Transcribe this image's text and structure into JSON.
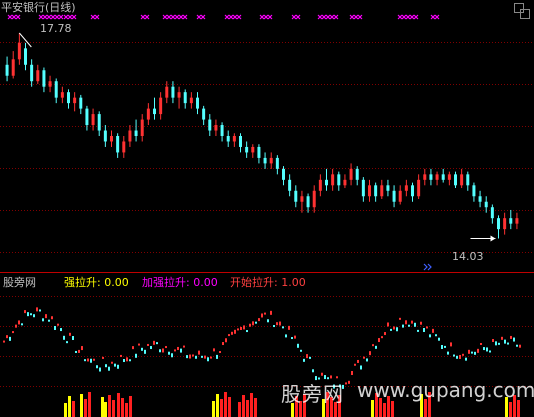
{
  "title_label": "平安银行(日线)",
  "high_label": "17.78",
  "low_label": "14.03",
  "indicator": {
    "name": "股旁网",
    "v1": "强拉升: 0.00",
    "v2": "加强拉升: 0.00",
    "v3": "开始拉升: 1.00"
  },
  "watermark": {
    "cn": "股旁网",
    "url": "www.gupang.com"
  },
  "colors": {
    "background": "#000000",
    "up": "#ff3232",
    "down": "#54ffff",
    "grid": "#800000",
    "separator": "#c00000",
    "marker": "#ff00ff",
    "text_label": "#c0c0c0",
    "v1": "#ffff00",
    "v2": "#ff00ff",
    "v3": "#ff4040",
    "bar_yellow": "#ffff00",
    "bar_red": "#ff2020"
  },
  "icons": {
    "marker": "magenta-x-marker",
    "arrow": "arrow-marker"
  },
  "chart_data": {
    "type": "candlestick",
    "ylim": [
      13.6,
      18.2
    ],
    "price_high": 17.78,
    "price_low": 14.03,
    "candles": [
      [
        17.2,
        17.0,
        17.35,
        16.9
      ],
      [
        17.0,
        17.3,
        17.45,
        16.95
      ],
      [
        17.3,
        17.6,
        17.78,
        17.2
      ],
      [
        17.5,
        17.2,
        17.6,
        17.1
      ],
      [
        17.2,
        16.9,
        17.3,
        16.8
      ],
      [
        16.9,
        17.1,
        17.2,
        16.85
      ],
      [
        17.1,
        16.8,
        17.15,
        16.7
      ],
      [
        16.8,
        16.9,
        17.0,
        16.7
      ],
      [
        16.9,
        16.6,
        16.95,
        16.5
      ],
      [
        16.6,
        16.7,
        16.8,
        16.5
      ],
      [
        16.7,
        16.5,
        16.75,
        16.4
      ],
      [
        16.5,
        16.6,
        16.7,
        16.35
      ],
      [
        16.6,
        16.4,
        16.65,
        16.3
      ],
      [
        16.4,
        16.1,
        16.45,
        16.0
      ],
      [
        16.1,
        16.3,
        16.4,
        16.0
      ],
      [
        16.3,
        16.0,
        16.35,
        15.9
      ],
      [
        16.0,
        15.8,
        16.1,
        15.7
      ],
      [
        15.8,
        15.9,
        16.0,
        15.7
      ],
      [
        15.9,
        15.6,
        15.95,
        15.5
      ],
      [
        15.6,
        15.8,
        15.9,
        15.5
      ],
      [
        15.8,
        16.0,
        16.1,
        15.7
      ],
      [
        16.0,
        15.9,
        16.2,
        15.8
      ],
      [
        15.9,
        16.2,
        16.3,
        15.8
      ],
      [
        16.2,
        16.4,
        16.5,
        16.1
      ],
      [
        16.4,
        16.3,
        16.6,
        16.2
      ],
      [
        16.3,
        16.6,
        16.7,
        16.2
      ],
      [
        16.6,
        16.8,
        16.9,
        16.5
      ],
      [
        16.8,
        16.6,
        16.9,
        16.5
      ],
      [
        16.6,
        16.7,
        16.8,
        16.4
      ],
      [
        16.7,
        16.5,
        16.75,
        16.4
      ],
      [
        16.5,
        16.6,
        16.7,
        16.4
      ],
      [
        16.6,
        16.4,
        16.7,
        16.3
      ],
      [
        16.4,
        16.2,
        16.45,
        16.1
      ],
      [
        16.2,
        16.0,
        16.3,
        15.9
      ],
      [
        16.0,
        16.1,
        16.2,
        15.9
      ],
      [
        16.1,
        15.9,
        16.15,
        15.8
      ],
      [
        15.9,
        15.8,
        16.0,
        15.7
      ],
      [
        15.8,
        15.9,
        15.95,
        15.7
      ],
      [
        15.9,
        15.7,
        15.95,
        15.6
      ],
      [
        15.7,
        15.6,
        15.8,
        15.5
      ],
      [
        15.6,
        15.7,
        15.75,
        15.5
      ],
      [
        15.7,
        15.5,
        15.75,
        15.4
      ],
      [
        15.5,
        15.4,
        15.6,
        15.3
      ],
      [
        15.4,
        15.5,
        15.6,
        15.3
      ],
      [
        15.5,
        15.3,
        15.55,
        15.2
      ],
      [
        15.3,
        15.1,
        15.35,
        15.0
      ],
      [
        15.1,
        14.9,
        15.2,
        14.8
      ],
      [
        14.9,
        14.7,
        15.0,
        14.6
      ],
      [
        14.7,
        14.8,
        14.9,
        14.5
      ],
      [
        14.8,
        14.6,
        14.85,
        14.5
      ],
      [
        14.6,
        14.9,
        15.0,
        14.5
      ],
      [
        14.9,
        15.1,
        15.2,
        14.8
      ],
      [
        15.1,
        15.0,
        15.3,
        14.9
      ],
      [
        15.0,
        15.2,
        15.3,
        14.9
      ],
      [
        15.2,
        15.0,
        15.25,
        14.9
      ],
      [
        15.0,
        15.1,
        15.2,
        14.95
      ],
      [
        15.1,
        15.3,
        15.4,
        15.0
      ],
      [
        15.3,
        15.1,
        15.35,
        15.0
      ],
      [
        15.1,
        14.8,
        15.15,
        14.7
      ],
      [
        14.8,
        15.0,
        15.1,
        14.7
      ],
      [
        15.0,
        14.8,
        15.05,
        14.7
      ],
      [
        14.8,
        15.0,
        15.1,
        14.75
      ],
      [
        15.0,
        14.9,
        15.1,
        14.8
      ],
      [
        14.9,
        14.7,
        15.0,
        14.6
      ],
      [
        14.7,
        14.9,
        15.0,
        14.65
      ],
      [
        14.9,
        15.0,
        15.1,
        14.8
      ],
      [
        15.0,
        14.8,
        15.05,
        14.7
      ],
      [
        14.8,
        15.1,
        15.2,
        14.75
      ],
      [
        15.1,
        15.2,
        15.3,
        15.0
      ],
      [
        15.2,
        15.1,
        15.3,
        15.0
      ],
      [
        15.1,
        15.2,
        15.25,
        15.0
      ],
      [
        15.2,
        15.1,
        15.3,
        15.05
      ],
      [
        15.1,
        15.2,
        15.25,
        15.0
      ],
      [
        15.2,
        15.0,
        15.25,
        14.95
      ],
      [
        15.0,
        15.2,
        15.3,
        14.95
      ],
      [
        15.2,
        15.0,
        15.25,
        14.9
      ],
      [
        15.0,
        14.8,
        15.05,
        14.7
      ],
      [
        14.8,
        14.7,
        14.9,
        14.6
      ],
      [
        14.7,
        14.6,
        14.8,
        14.5
      ],
      [
        14.6,
        14.4,
        14.65,
        14.3
      ],
      [
        14.4,
        14.2,
        14.45,
        14.03
      ],
      [
        14.2,
        14.4,
        14.5,
        14.1
      ],
      [
        14.4,
        14.3,
        14.55,
        14.2
      ],
      [
        14.3,
        14.4,
        14.5,
        14.2
      ]
    ]
  }
}
